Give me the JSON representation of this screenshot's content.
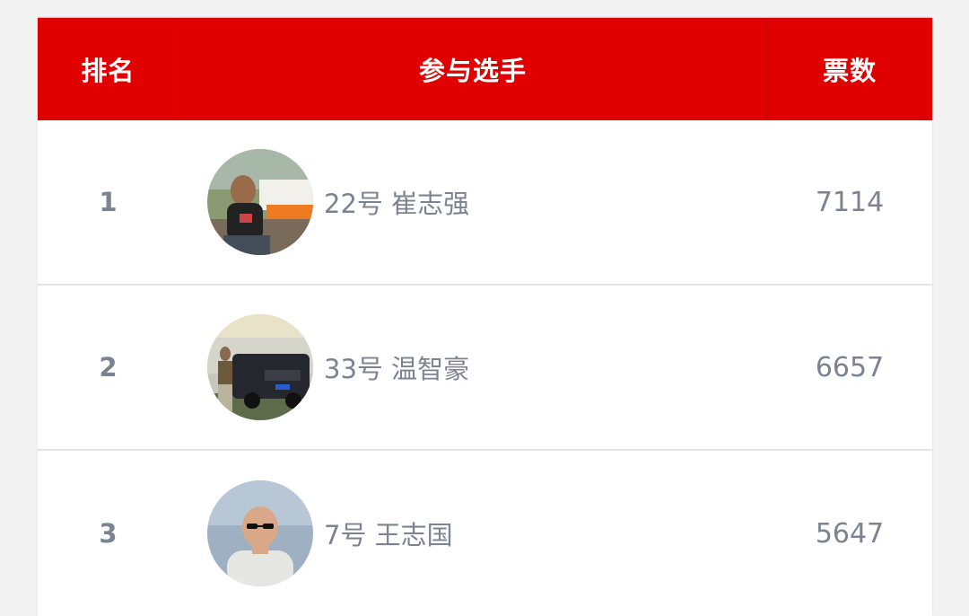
{
  "header": {
    "rank_label": "排名",
    "player_label": "参与选手",
    "votes_label": "票数"
  },
  "rows": [
    {
      "rank": "1",
      "name": "22号 崔志强",
      "votes": "7114"
    },
    {
      "rank": "2",
      "name": "33号 温智豪",
      "votes": "6657"
    },
    {
      "rank": "3",
      "name": "7号 王志国",
      "votes": "5647"
    }
  ],
  "colors": {
    "header_bg": "#e10000",
    "header_text": "#ffffff",
    "body_text": "#7c8390",
    "background": "#f3f3f4"
  }
}
